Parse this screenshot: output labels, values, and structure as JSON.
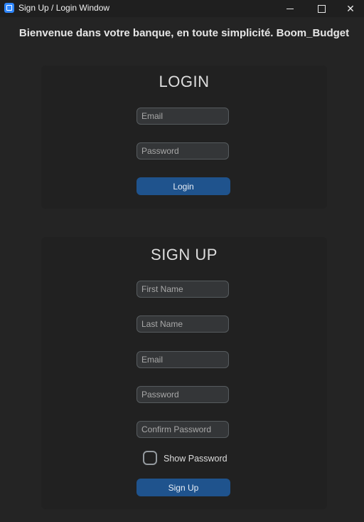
{
  "window": {
    "title": "Sign Up / Login Window",
    "controls": {
      "minimize": "minimize",
      "maximize": "maximize",
      "close": "✕"
    }
  },
  "welcome_text": "Bienvenue dans votre banque, en toute simplicité. Boom_Budget",
  "login": {
    "title": "LOGIN",
    "email_placeholder": "Email",
    "password_placeholder": "Password",
    "button_label": "Login"
  },
  "signup": {
    "title": "SIGN UP",
    "first_name_placeholder": "First Name",
    "last_name_placeholder": "Last Name",
    "email_placeholder": "Email",
    "password_placeholder": "Password",
    "confirm_password_placeholder": "Confirm Password",
    "show_password_label": "Show Password",
    "button_label": "Sign Up"
  },
  "colors": {
    "background": "#242424",
    "panel": "#212121",
    "field_bg": "#343638",
    "field_border": "#565b5e",
    "button": "#1f538d",
    "app_icon": "#2f87ff"
  }
}
